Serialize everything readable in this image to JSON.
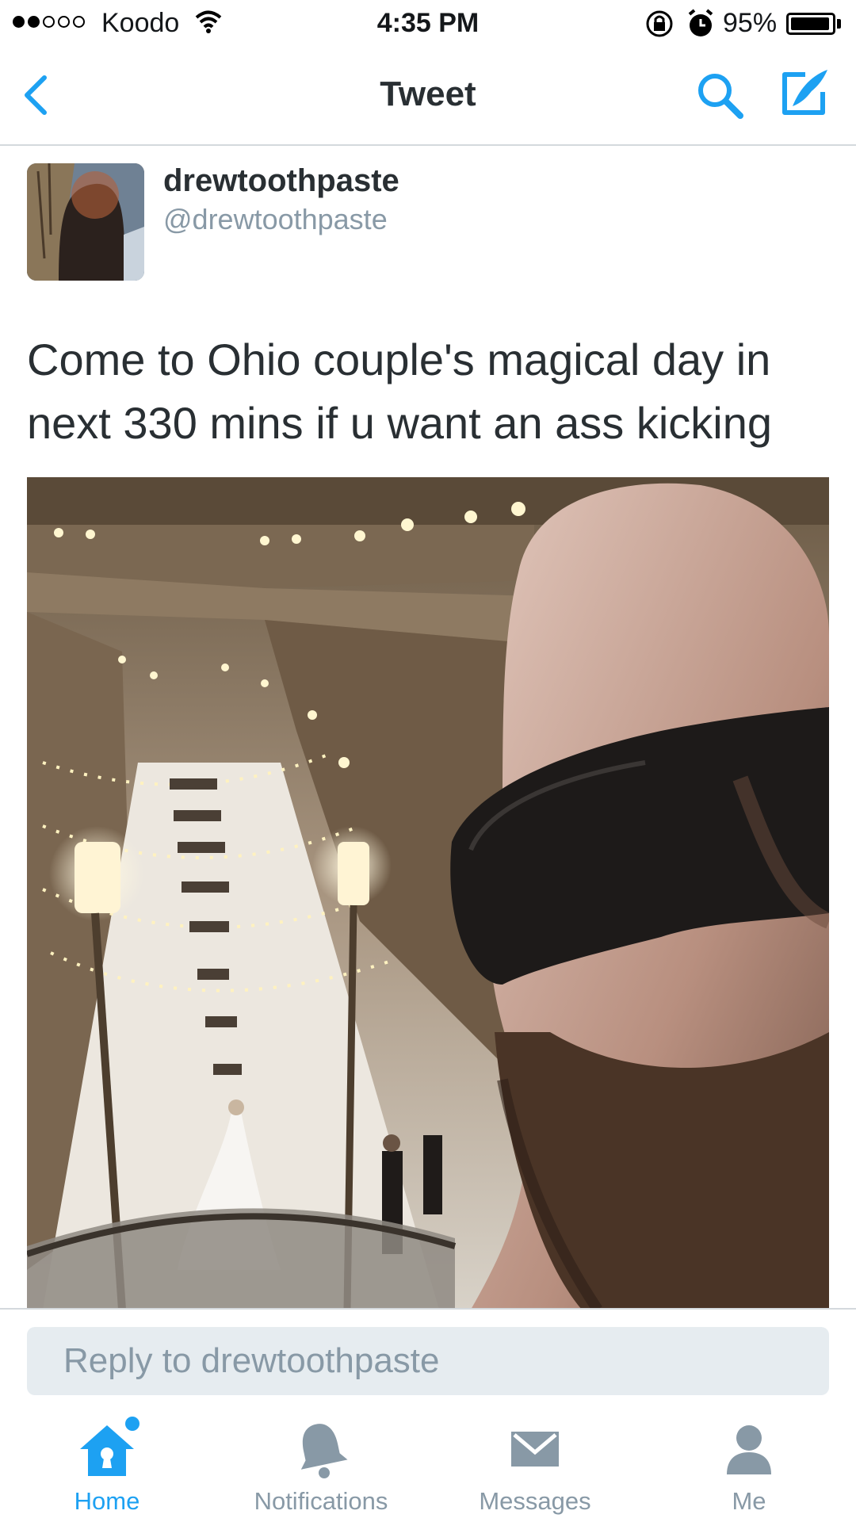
{
  "status_bar": {
    "carrier": "Koodo",
    "time": "4:35 PM",
    "battery": "95%",
    "battery_level": 0.95
  },
  "nav": {
    "title": "Tweet",
    "accent_color": "#1da1f2"
  },
  "tweet": {
    "display_name": "drewtoothpaste",
    "handle": "@drewtoothpaste",
    "text": "Come to Ohio couple's magical day in next 330 mins if u want an ass kicking"
  },
  "reply": {
    "placeholder": "Reply to drewtoothpaste"
  },
  "tab_bar": {
    "tabs": [
      {
        "label": "Home",
        "icon": "home-icon",
        "active": true
      },
      {
        "label": "Notifications",
        "icon": "bell-icon",
        "active": false
      },
      {
        "label": "Messages",
        "icon": "envelope-icon",
        "active": false
      },
      {
        "label": "Me",
        "icon": "person-icon",
        "active": false
      }
    ],
    "active_color": "#1da1f2",
    "inactive_color": "#8899a6"
  }
}
